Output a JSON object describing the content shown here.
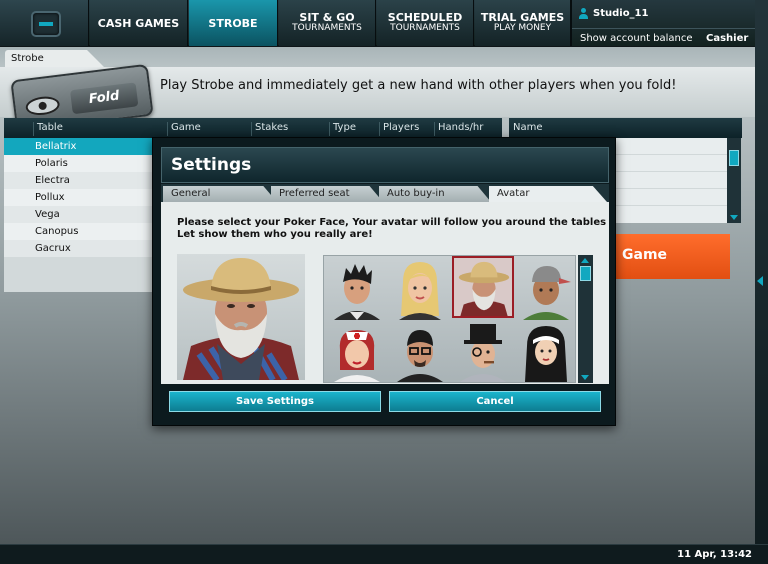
{
  "nav": {
    "tabs": [
      {
        "label": "CASH GAMES",
        "sub": ""
      },
      {
        "label": "STROBE",
        "sub": ""
      },
      {
        "label": "SIT & GO",
        "sub": "TOURNAMENTS"
      },
      {
        "label": "SCHEDULED",
        "sub": "TOURNAMENTS"
      },
      {
        "label": "TRIAL GAMES",
        "sub": "PLAY MONEY"
      }
    ],
    "active_tab": "STROBE"
  },
  "account": {
    "username": "Studio_11",
    "show_balance": "Show account balance",
    "cashier": "Cashier"
  },
  "subtab": "Strobe",
  "promo": {
    "fold_label": "Fold",
    "text": "Play Strobe and immediately get a new hand with other players when you fold!"
  },
  "table_headers": [
    "Table",
    "Game",
    "Stakes",
    "Type",
    "Players",
    "Hands/hr"
  ],
  "name_header": "Name",
  "tables": [
    "Bellatrix",
    "Polaris",
    "Electra",
    "Pollux",
    "Vega",
    "Canopus",
    "Gacrux"
  ],
  "selected_table": "Bellatrix",
  "game_button": "Game",
  "settings": {
    "title": "Settings",
    "tabs": [
      "General",
      "Preferred seat",
      "Auto buy-in",
      "Avatar"
    ],
    "active_tab": "Avatar",
    "intro_line1": "Please select your Poker Face, Your avatar will follow you around the tables",
    "intro_line2": "Let show them who you really are!",
    "avatars": [
      "spiky-hair-man",
      "blonde-woman",
      "farmer-straw-hat",
      "cap-man",
      "nurse",
      "glasses-man",
      "monocle-top-hat-man",
      "nun"
    ],
    "selected_avatar": "farmer-straw-hat",
    "save_label": "Save Settings",
    "cancel_label": "Cancel"
  },
  "status": {
    "datetime": "11 Apr, 13:42"
  },
  "colors": {
    "accent": "#11a8c0",
    "game_button": "#f05a1c",
    "selected_avatar_border": "#9b1d25"
  }
}
